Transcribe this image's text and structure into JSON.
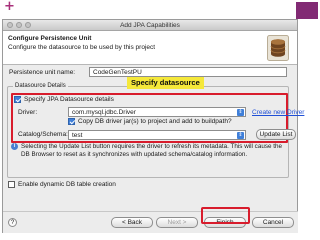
{
  "decor": {
    "plus": "+"
  },
  "window": {
    "title": "Add JPA Capabilities"
  },
  "banner": {
    "title": "Configure Persistence Unit",
    "subtitle": "Configure the datasource to be used by this project",
    "icon": "database-icon"
  },
  "persistence_unit": {
    "label": "Persistence unit name:",
    "value": "CodeGenTestPU"
  },
  "callout": "Specify datasource",
  "datasource": {
    "group_label": "Datasource Details",
    "specify_checkbox": {
      "label": "Specify JPA Datasource details",
      "checked": true
    },
    "driver": {
      "label": "Driver:",
      "value": "com.mysql.jdbc.Driver",
      "link": "Create new Driver"
    },
    "copy_checkbox": {
      "label": "Copy DB driver jar(s) to project and add to buildpath?",
      "checked": true
    },
    "catalog": {
      "label": "Catalog/Schema:",
      "value": "test",
      "button": "Update List"
    },
    "info": "Selecting the Update List button requires the driver to refresh its metadata. This will cause the DB Browser to reset as it synchronizes with updated schema/catalog information."
  },
  "dynamic_checkbox": {
    "label": "Enable dynamic DB table creation",
    "checked": false
  },
  "footer": {
    "help": "?",
    "back": "< Back",
    "next": "Next >",
    "finish": "Finish",
    "cancel": "Cancel"
  },
  "colors": {
    "highlight_red": "#d81c2c",
    "callout_yellow": "#f5e83a",
    "accent": "#822a74",
    "link_blue": "#1f4fd6"
  }
}
